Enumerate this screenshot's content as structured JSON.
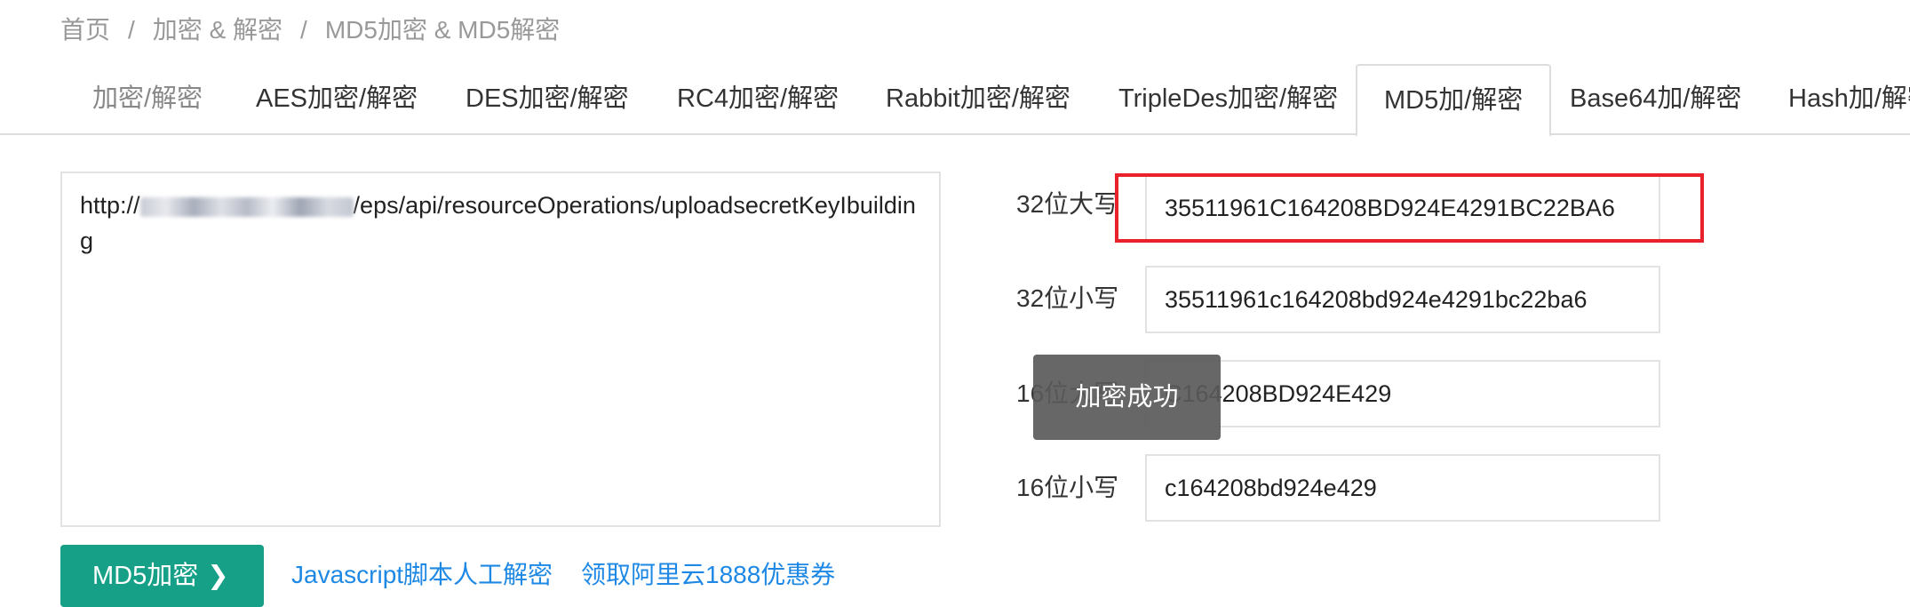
{
  "breadcrumb": {
    "items": [
      "首页",
      "加密 & 解密",
      "MD5加密 & MD5解密"
    ],
    "separator": "/"
  },
  "tabs": [
    {
      "label": "加密/解密",
      "active": false
    },
    {
      "label": "AES加密/解密",
      "active": false
    },
    {
      "label": "DES加密/解密",
      "active": false
    },
    {
      "label": "RC4加密/解密",
      "active": false
    },
    {
      "label": "Rabbit加密/解密",
      "active": false
    },
    {
      "label": "TripleDes加密/解密",
      "active": false
    },
    {
      "label": "MD5加/解密",
      "active": true
    },
    {
      "label": "Base64加/解密",
      "active": false
    },
    {
      "label": "Hash加/解密",
      "active": false
    }
  ],
  "input": {
    "prefix": "http://",
    "suffix": "/eps/api/resourceOperations/uploadsecretKeyIbuilding"
  },
  "results": [
    {
      "label": "32位大写",
      "value": "35511961C164208BD924E4291BC22BA6"
    },
    {
      "label": "32位小写",
      "value": "35511961c164208bd924e4291bc22ba6"
    },
    {
      "label": "16位大写",
      "value": "C164208BD924E429"
    },
    {
      "label": "16位小写",
      "value": "c164208bd924e429"
    }
  ],
  "toast": {
    "text": "加密成功"
  },
  "actions": {
    "md5_button": "MD5加密",
    "md5_button_chevron": "❯",
    "link_js": "Javascript脚本人工解密",
    "link_aliyun": "领取阿里云1888优惠券"
  },
  "colors": {
    "accent": "#17a088",
    "link": "#1e88e5",
    "highlight": "#e8212b"
  }
}
